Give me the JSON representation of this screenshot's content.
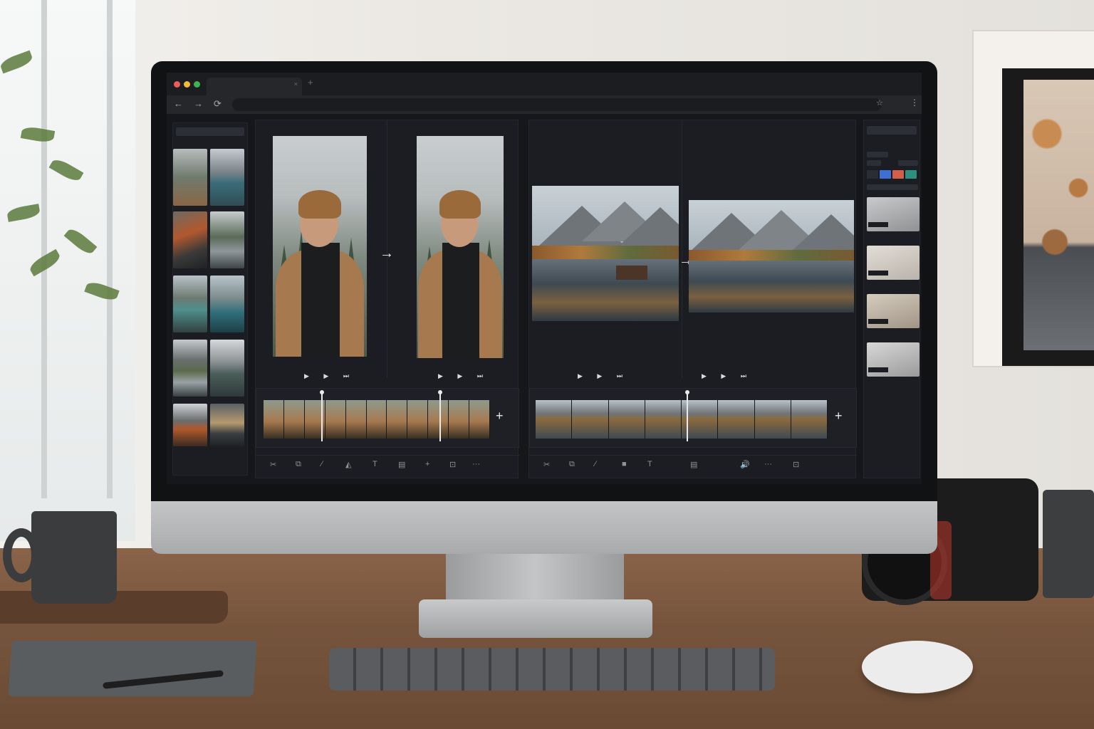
{
  "browser": {
    "tab_title": "",
    "tab_close": "×",
    "new_tab": "+",
    "back": "←",
    "forward": "→",
    "reload": "⟳",
    "bookmark": "☆",
    "menu": "⋮",
    "window_controls": {
      "close": "#ed5c57",
      "minimize": "#f2b93b",
      "maximize": "#3cb64b"
    }
  },
  "editor_a": {
    "transition_arrow": "→",
    "player_controls": "▶ ▶ ⏭",
    "add_clip": "+",
    "tools": [
      "✂",
      "⧉",
      "⁄",
      "◭",
      "T",
      "▤",
      "+",
      "⊡",
      "···"
    ]
  },
  "editor_b": {
    "transition_arrow": "→",
    "player_controls": "▶ ▶ ⏭",
    "add_clip": "+",
    "tools": [
      "✂",
      "⧉",
      "⁄",
      "■",
      "T",
      "▤",
      "🔊",
      "···",
      "⊡"
    ]
  },
  "right_panel": {
    "swatches": [
      "#2a2d33",
      "#3f6fd1",
      "#d35e4a",
      "#2f8f7f"
    ]
  }
}
